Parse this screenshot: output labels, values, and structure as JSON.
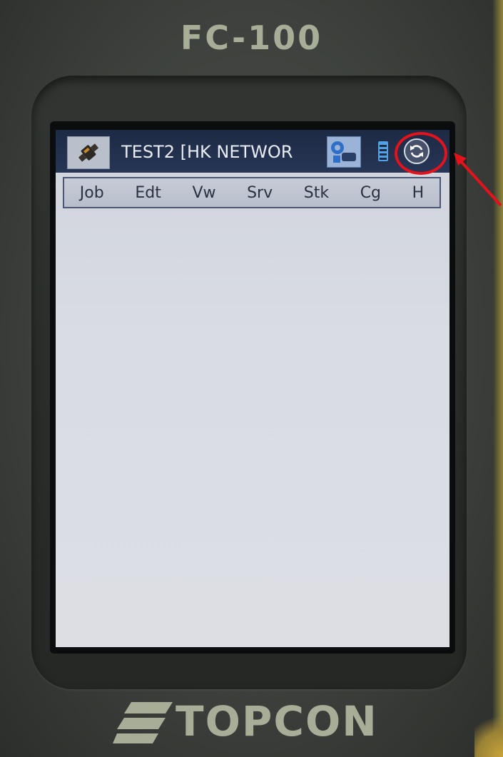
{
  "device": {
    "model": "FC-100",
    "brand": "TOPCON"
  },
  "titlebar": {
    "job_title": "TEST2 [HK NETWOR",
    "app_icon": "satellite-icon",
    "network_icon": "network-status-icon",
    "battery_icon": "battery-icon",
    "sync_icon": "sync-icon"
  },
  "menu": {
    "items": [
      "Job",
      "Edt",
      "Vw",
      "Srv",
      "Stk",
      "Cg",
      "H"
    ]
  },
  "annotation": {
    "color": "#e3121b"
  }
}
